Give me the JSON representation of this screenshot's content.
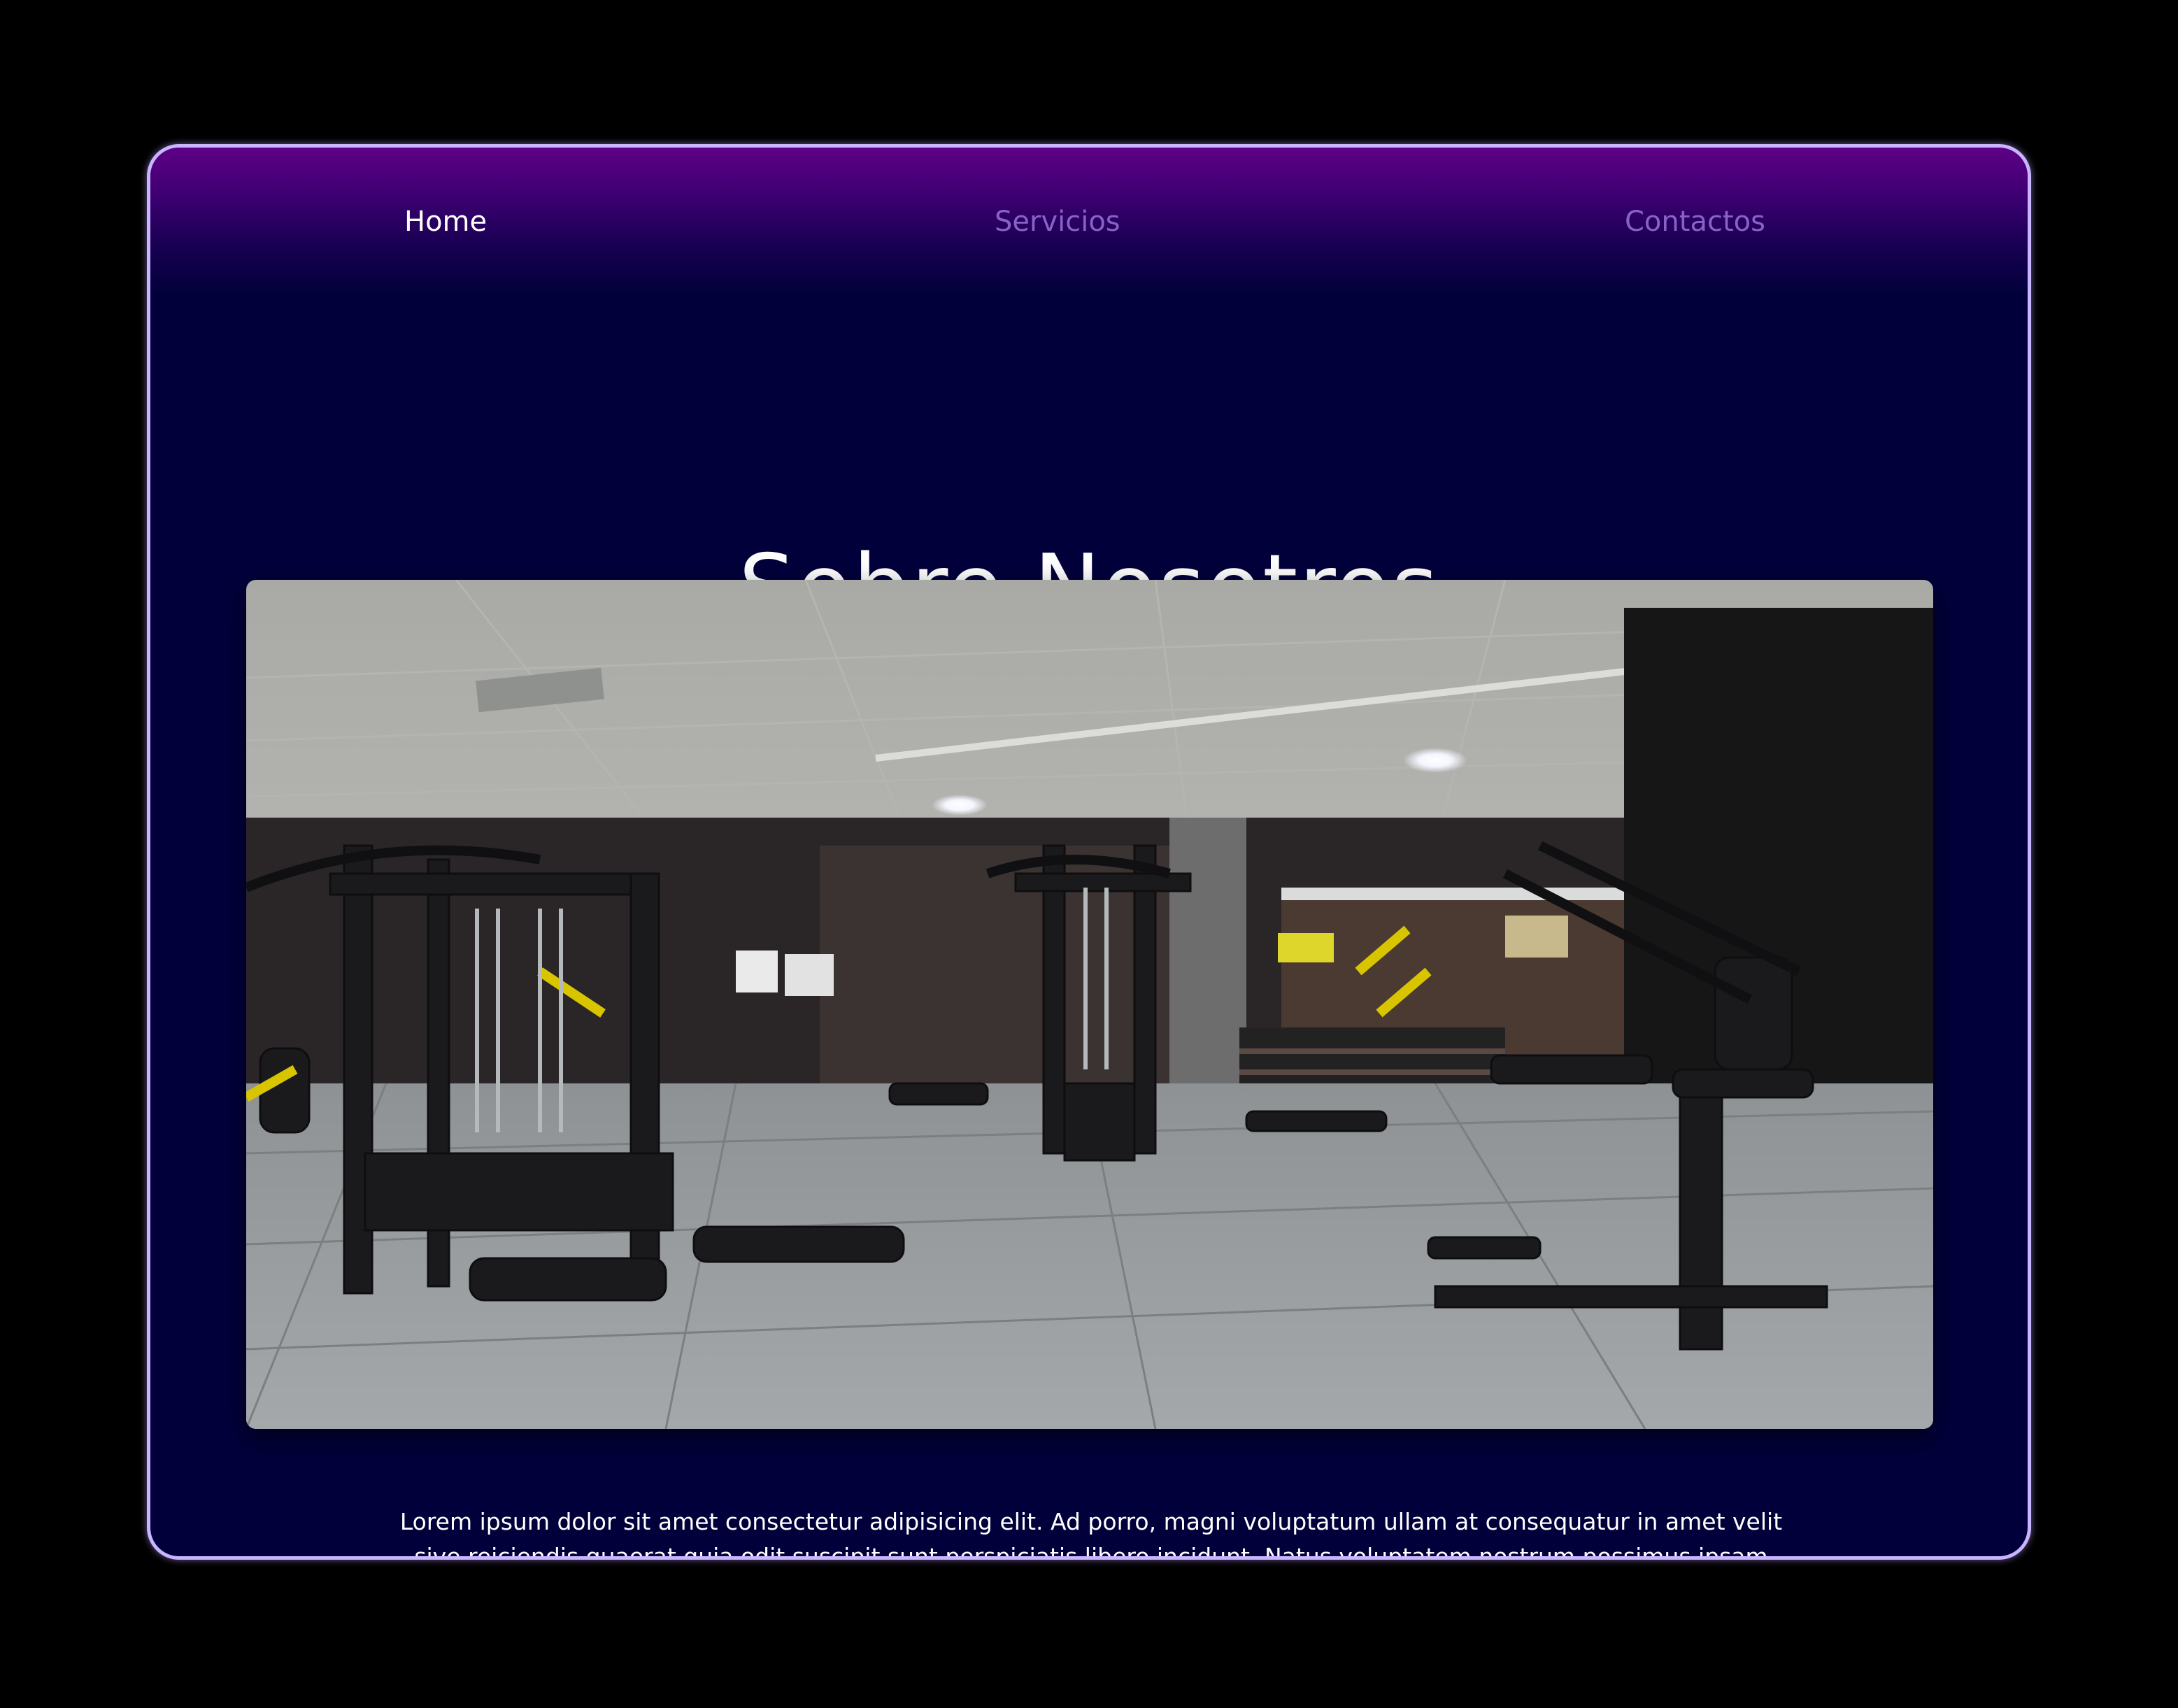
{
  "nav": {
    "home": "Home",
    "services": "Servicios",
    "contact": "Contactos"
  },
  "hero": {
    "title": "Sobre Nosotros"
  },
  "about": {
    "image_alt": "gym-interior-photo",
    "paragraph": "Lorem ipsum dolor sit amet consectetur adipisicing elit. Ad porro, magni voluptatum ullam at consequatur in amet velit sive reiciendis quaerat quia odit suscipit sunt perspiciatis libero incidunt. Natus voluptatem nostrum possimus ipsam"
  },
  "colors": {
    "page_background": "#000000",
    "frame_border": "#c9b4ff",
    "panel_background": "#02003b",
    "header_gradient_top": "#5f0086",
    "nav_active": "#ffffff",
    "nav_inactive": "#8763c8"
  }
}
